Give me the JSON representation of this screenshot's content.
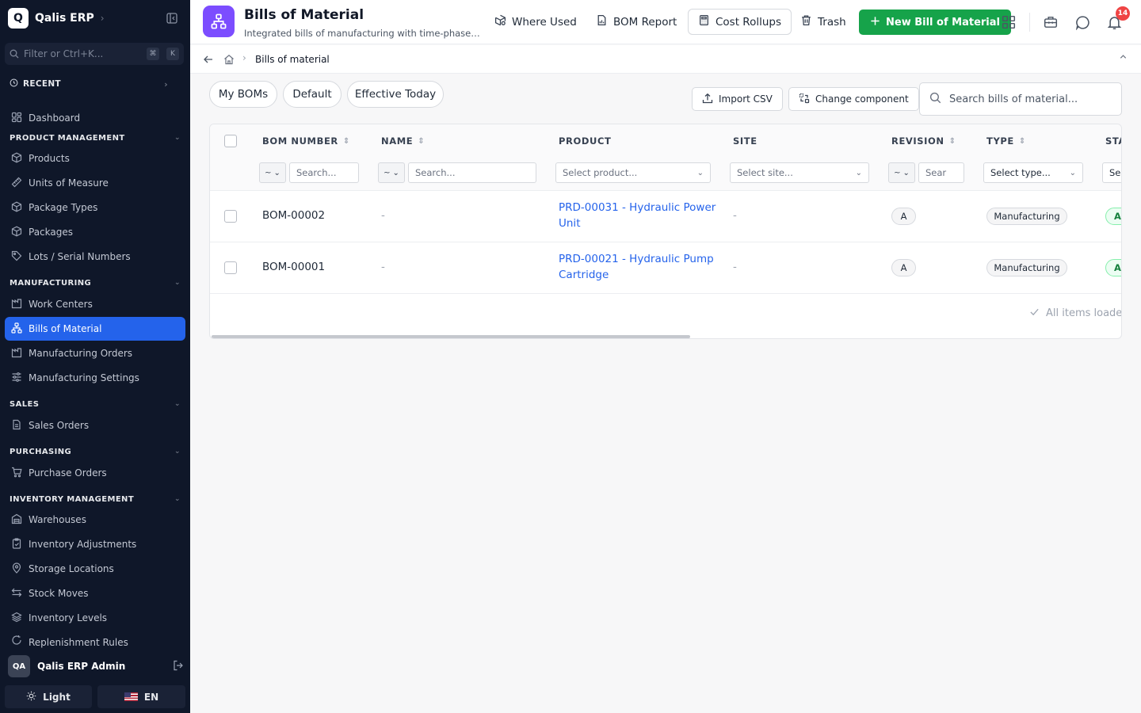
{
  "app": {
    "logo_letter": "Q",
    "name": "Qalis ERP"
  },
  "sidebar": {
    "filter_placeholder": "Filter or Ctrl+K...",
    "kbd_cmd": "⌘",
    "kbd_k": "K",
    "recent_label": "RECENT",
    "dashboard_label": "Dashboard",
    "sections": {
      "product_management": "PRODUCT MANAGEMENT",
      "manufacturing": "MANUFACTURING",
      "sales": "SALES",
      "purchasing": "PURCHASING",
      "inventory_management": "INVENTORY MANAGEMENT"
    },
    "items": {
      "products": "Products",
      "units_of_measure": "Units of Measure",
      "package_types": "Package Types",
      "packages": "Packages",
      "lots_serial": "Lots / Serial Numbers",
      "work_centers": "Work Centers",
      "bills_of_material": "Bills of Material",
      "manufacturing_orders": "Manufacturing Orders",
      "manufacturing_settings": "Manufacturing Settings",
      "sales_orders": "Sales Orders",
      "purchase_orders": "Purchase Orders",
      "warehouses": "Warehouses",
      "inventory_adjustments": "Inventory Adjustments",
      "storage_locations": "Storage Locations",
      "stock_moves": "Stock Moves",
      "inventory_levels": "Inventory Levels",
      "replenishment_rules": "Replenishment Rules"
    },
    "user": {
      "initials": "QA",
      "name": "Qalis ERP Admin"
    },
    "theme_label": "Light",
    "language_label": "EN"
  },
  "header": {
    "title": "Bills of Material",
    "subtitle": "Integrated bills of manufacturing with time-phased ma...",
    "where_used": "Where Used",
    "bom_report": "BOM Report",
    "cost_rollups": "Cost Rollups",
    "trash": "Trash",
    "new_bom": "New Bill of Material",
    "notification_count": "14"
  },
  "breadcrumb": {
    "current": "Bills of material"
  },
  "toolbar": {
    "views": [
      "My BOMs",
      "Default",
      "Effective Today"
    ],
    "import_csv": "Import CSV",
    "change_component": "Change component",
    "search_placeholder": "Search bills of material..."
  },
  "table": {
    "columns": {
      "bom_number": "BOM NUMBER",
      "name": "NAME",
      "product": "PRODUCT",
      "site": "SITE",
      "revision": "REVISION",
      "type": "TYPE",
      "status": "STA"
    },
    "filters": {
      "operator": "~",
      "search": "Search...",
      "select_product": "Select product...",
      "select_site": "Select site...",
      "revision_search": "Sear",
      "select_type": "Select type...",
      "status_select": "Sel"
    },
    "rows": [
      {
        "bom_number": "BOM-00002",
        "name": "-",
        "product": "PRD-00031 - Hydraulic Power Unit",
        "site": "-",
        "revision": "A",
        "type": "Manufacturing",
        "status": "Active"
      },
      {
        "bom_number": "BOM-00001",
        "name": "-",
        "product": "PRD-00021 - Hydraulic Pump Cartridge",
        "site": "-",
        "revision": "A",
        "type": "Manufacturing",
        "status": "Active"
      }
    ],
    "all_loaded": "All items loaded"
  },
  "colors": {
    "sidebar_bg": "#0f1729",
    "active_nav": "#2463eb",
    "primary_green": "#16a34a",
    "app_icon": "#7c4dff",
    "link": "#2563eb",
    "badge": "#ef4444"
  }
}
